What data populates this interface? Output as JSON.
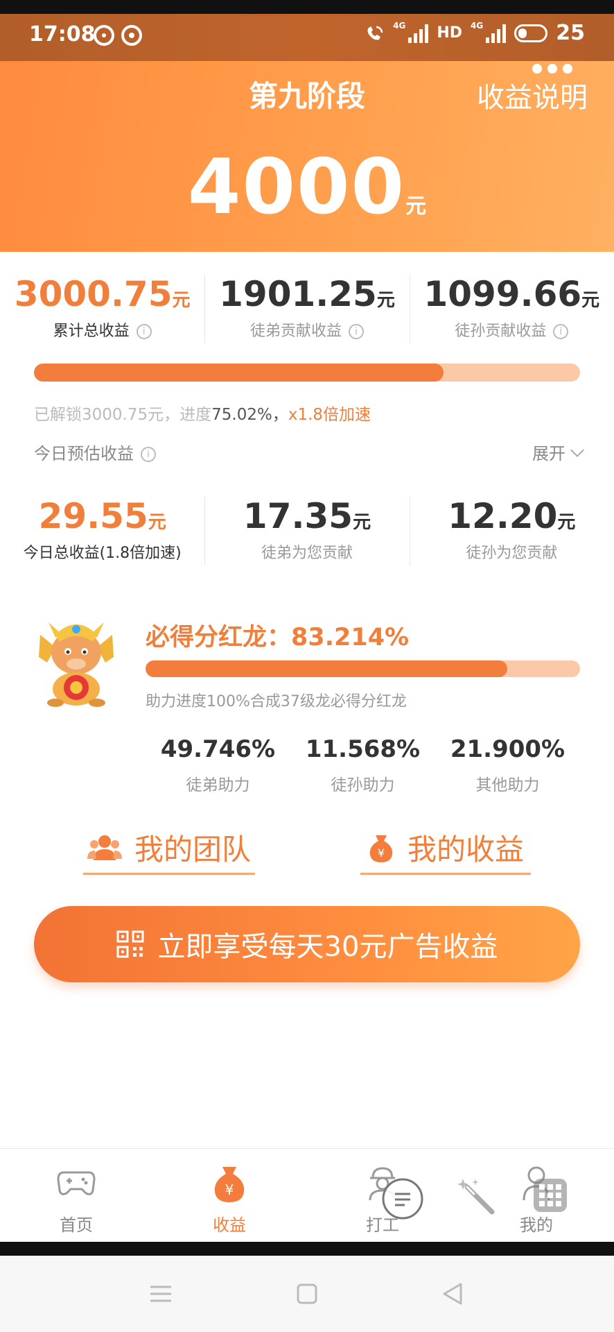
{
  "status_bar": {
    "time": "17:08",
    "net1": "4G",
    "hd": "HD",
    "net2": "4G",
    "battery": "25"
  },
  "header": {
    "title": "第九阶段",
    "explain_link": "收益说明",
    "amount": "4000",
    "unit": "元"
  },
  "totals": [
    {
      "value": "3000.75",
      "unit": "元",
      "label": "累计总收益"
    },
    {
      "value": "1901.25",
      "unit": "元",
      "label": "徒弟贡献收益"
    },
    {
      "value": "1099.66",
      "unit": "元",
      "label": "徒孙贡献收益"
    }
  ],
  "progress": {
    "percent": 75.02,
    "text_prefix": "已解锁3000.75元，进度",
    "text_value": "75.02%，",
    "speedup": "x1.8倍加速"
  },
  "today": {
    "title": "今日预估收益",
    "expand": "展开",
    "stats": [
      {
        "value": "29.55",
        "unit": "元",
        "label": "今日总收益(1.8倍加速)"
      },
      {
        "value": "17.35",
        "unit": "元",
        "label": "徒弟为您贡献"
      },
      {
        "value": "12.20",
        "unit": "元",
        "label": "徒孙为您贡献"
      }
    ]
  },
  "dragon": {
    "title": "必得分红龙：83.214%",
    "percent": 83.214,
    "description": "助力进度100%合成37级龙必得分红龙",
    "help": [
      {
        "value": "49.746%",
        "label": "徒弟助力"
      },
      {
        "value": "11.568%",
        "label": "徒孙助力"
      },
      {
        "value": "21.900%",
        "label": "其他助力"
      }
    ]
  },
  "links": {
    "team": "我的团队",
    "earnings": "我的收益"
  },
  "cta": {
    "label": "立即享受每天30元广告收益"
  },
  "tabs": [
    {
      "label": "首页",
      "icon": "gamepad-icon"
    },
    {
      "label": "收益",
      "icon": "money-bag-icon"
    },
    {
      "label": "打工",
      "icon": "worker-icon"
    },
    {
      "label": "我的",
      "icon": "user-icon"
    }
  ],
  "colors": {
    "accent": "#f07f3c",
    "progress_track": "#fcc9a8",
    "header_start": "#ff8a3d",
    "header_end": "#ffb061"
  }
}
